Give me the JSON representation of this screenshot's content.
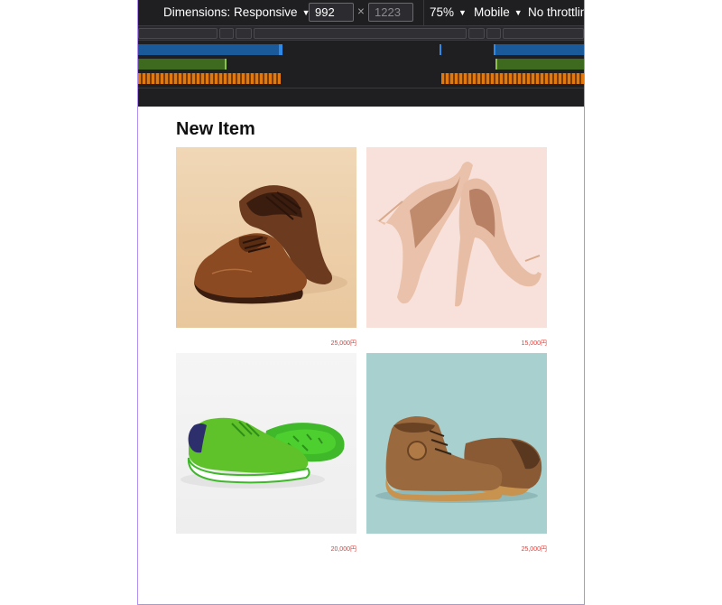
{
  "toolbar": {
    "dimensions_label": "Dimensions: Responsive",
    "width_value": "992",
    "height_placeholder": "1223",
    "times_symbol": "×",
    "zoom_label": "75%",
    "device_label": "Mobile",
    "throttling_label": "No throttling",
    "caret_icon": "▼"
  },
  "page": {
    "title": "New Item",
    "items": [
      {
        "price": "25,000円",
        "image": "brown-leather-oxford-shoes-photo"
      },
      {
        "price": "15,000円",
        "image": "nude-high-heel-pumps-photo"
      },
      {
        "price": "20,000円",
        "image": "green-suede-sneakers-photo"
      },
      {
        "price": "25,000円",
        "image": "brown-leather-boots-photo"
      }
    ]
  },
  "colors": {
    "price": "#e53935",
    "devtools_bg": "#1f1f22",
    "mq_blue": "#2e8ae6",
    "mq_green": "#8bc34a",
    "mq_orange": "#e07a10",
    "frame_border": "#b18ff0"
  }
}
